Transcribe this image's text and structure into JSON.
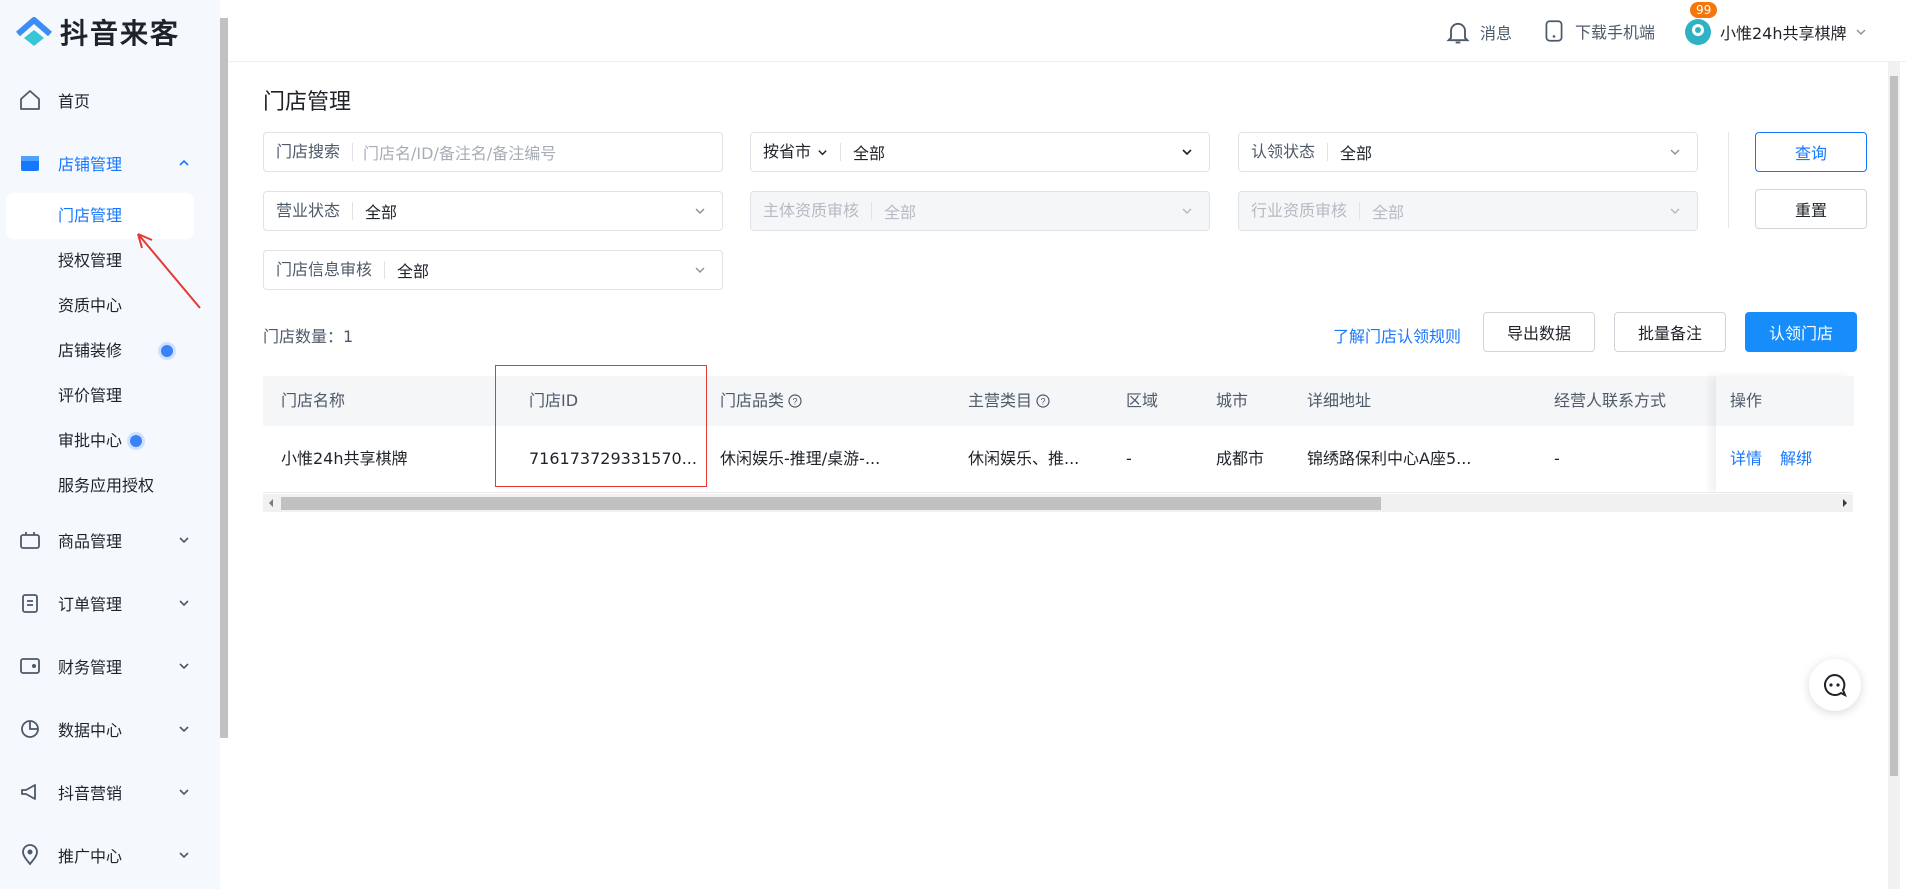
{
  "app": {
    "logo_text": "抖音来客",
    "brand_color": "#1677ff"
  },
  "topbar": {
    "messages_label": "消息",
    "messages_badge": "99",
    "download_label": "下载手机端",
    "user_name": "小惟24h共享棋牌"
  },
  "sidebar": {
    "home": "首页",
    "store_group": "店铺管理",
    "sub_items": [
      "门店管理",
      "授权管理",
      "资质中心",
      "店铺装修",
      "评价管理",
      "审批中心",
      "服务应用授权"
    ],
    "groups": [
      "商品管理",
      "订单管理",
      "财务管理",
      "数据中心",
      "抖音营销",
      "推广中心"
    ]
  },
  "page": {
    "title": "门店管理"
  },
  "filters": {
    "store_search": {
      "label": "门店搜索",
      "placeholder": "门店名/ID/备注名/备注编号"
    },
    "region": {
      "label": "按省市",
      "value": "全部"
    },
    "claim_status": {
      "label": "认领状态",
      "value": "全部"
    },
    "business_status": {
      "label": "营业状态",
      "value": "全部"
    },
    "entity_review": {
      "label": "主体资质审核",
      "value": "全部"
    },
    "industry_review": {
      "label": "行业资质审核",
      "value": "全部"
    },
    "info_review": {
      "label": "门店信息审核",
      "value": "全部"
    }
  },
  "buttons": {
    "query": "查询",
    "reset": "重置",
    "export": "导出数据",
    "batch_note": "批量备注",
    "claim_store": "认领门店"
  },
  "summary": {
    "count_label": "门店数量：1",
    "rules_link": "了解门店认领规则"
  },
  "table": {
    "headers": [
      "门店名称",
      "门店ID",
      "门店品类",
      "主营类目",
      "区域",
      "城市",
      "详细地址",
      "经营人联系方式",
      "操作"
    ],
    "rows": [
      {
        "name": "小惟24h共享棋牌",
        "id": "716173729331570...",
        "category": "休闲娱乐-推理/桌游-...",
        "main_category": "休闲娱乐、推...",
        "region": "-",
        "city": "成都市",
        "address": "锦绣路保利中心A座5...",
        "contact": "-",
        "actions": [
          "详情",
          "解绑"
        ]
      }
    ]
  }
}
